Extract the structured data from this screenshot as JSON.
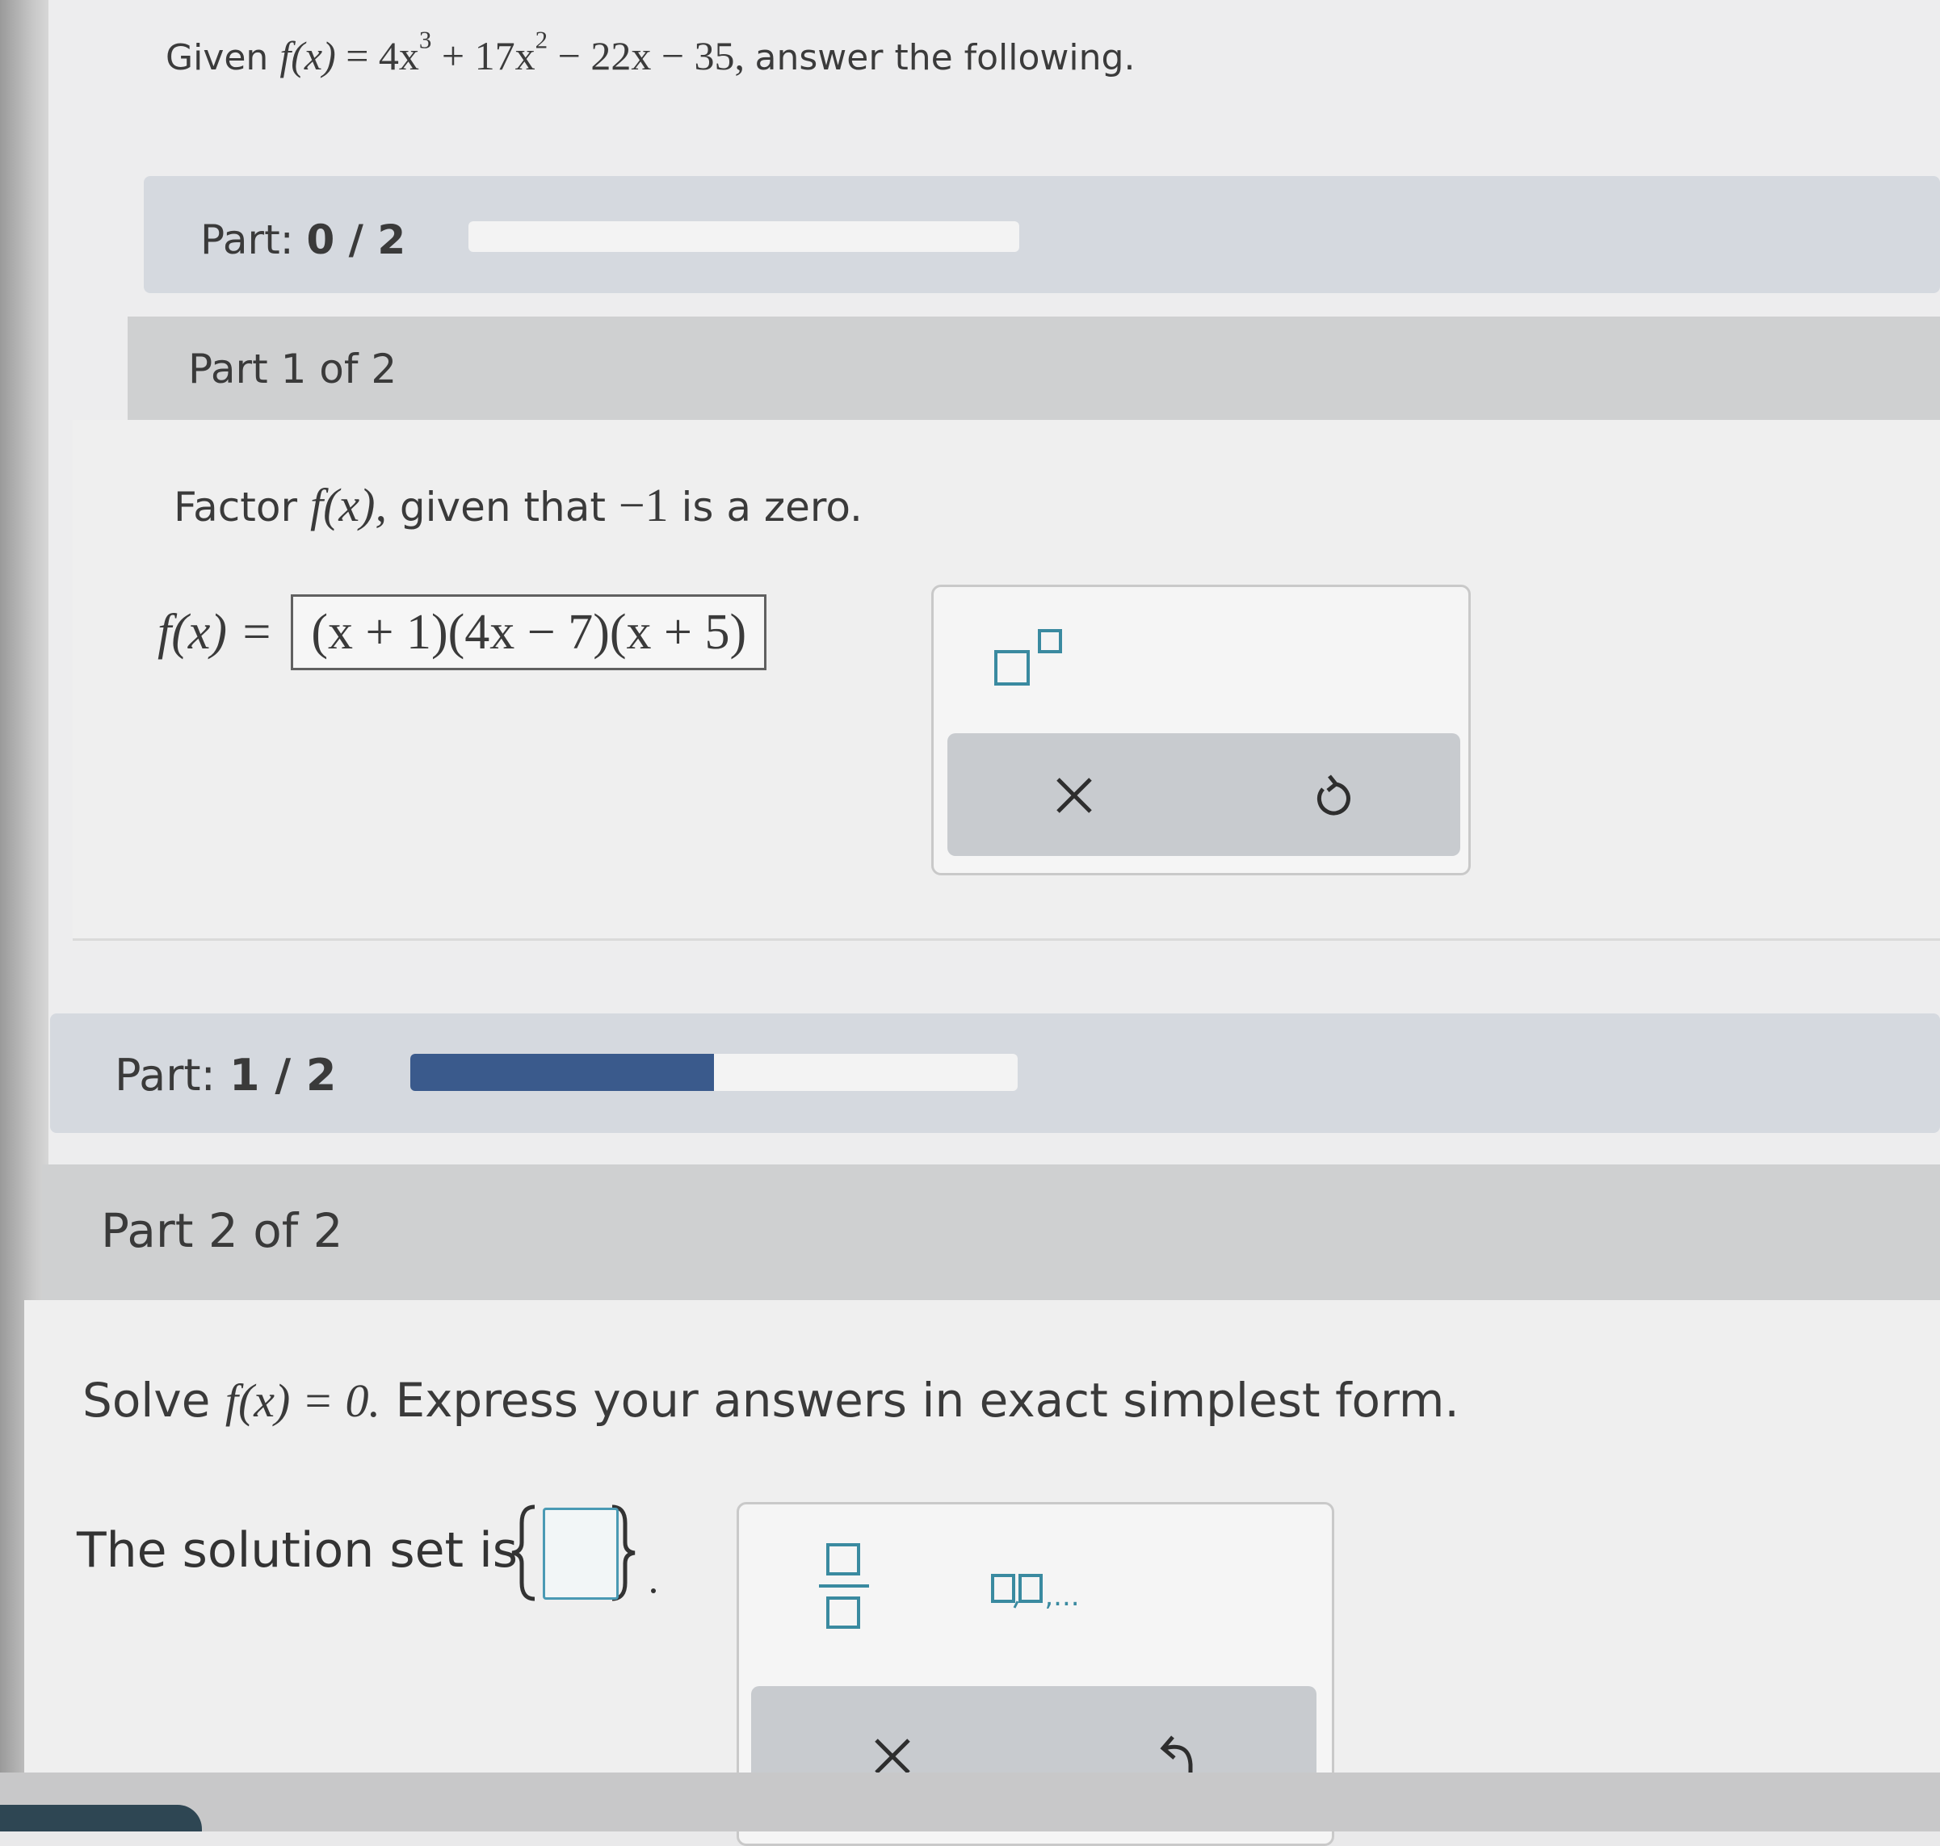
{
  "header": {
    "given_prefix": "Given",
    "function_lhs": "f(x)",
    "equals": "=",
    "t1_coef": "4x",
    "t1_exp": "3",
    "t2_coef": "+ 17x",
    "t2_exp": "2",
    "t_rest": "− 22x − 35,",
    "suffix": "answer the following."
  },
  "progress_top": {
    "label": "Part:",
    "value": "0 / 2",
    "fraction": 0.0
  },
  "part1": {
    "title": "Part 1 of 2",
    "prompt_prefix": "Factor",
    "prompt_func": "f(x),",
    "prompt_suffix_a": "given that",
    "prompt_zero": "−1",
    "prompt_suffix_b": "is a zero.",
    "answer_label": "f(x) =",
    "answer_value": "(x + 1)(4x − 7)(x + 5)"
  },
  "progress_mid": {
    "label": "Part:",
    "value": "1 / 2",
    "fraction": 0.5,
    "fill_color": "#3a5a8c"
  },
  "part2": {
    "title": "Part 2 of 2",
    "prompt_prefix": "Solve",
    "prompt_eq": "f(x) = 0.",
    "prompt_suffix": "Express your answers in exact simplest form.",
    "solution_prefix": "The solution set is",
    "list_suffix": ",..."
  },
  "icons": {
    "superscript": "superscript-template-icon",
    "fraction": "fraction-template-icon",
    "list": "list-template-icon",
    "clear": "close-icon",
    "undo": "undo-icon"
  },
  "colors": {
    "accent": "#3a5a8c",
    "teal_icon": "#3a8aa0"
  }
}
